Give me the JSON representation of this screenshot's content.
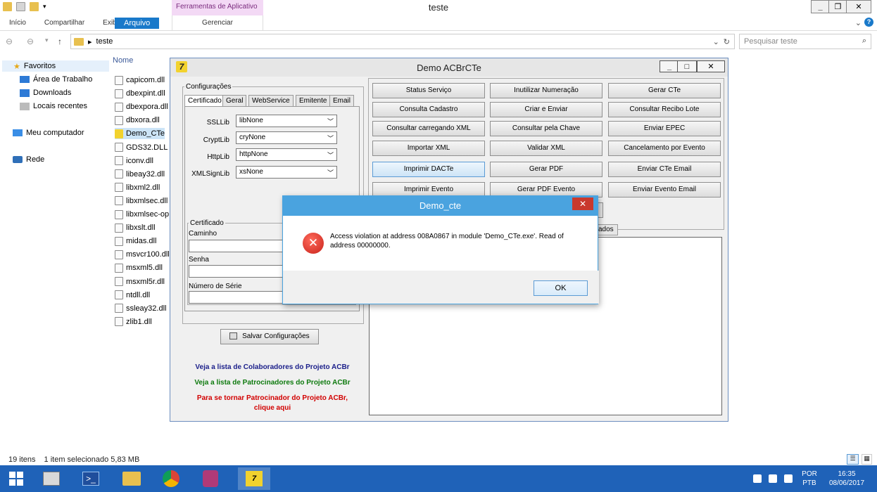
{
  "explorer": {
    "window_title": "teste",
    "context_tab": "Ferramentas de Aplicativo",
    "context_subtab": "Gerenciar",
    "ribbon_tabs": [
      "Arquivo",
      "Início",
      "Compartilhar",
      "Exibir"
    ],
    "breadcrumb": "teste",
    "search_placeholder": "Pesquisar teste",
    "nav": {
      "favorites": "Favoritos",
      "desktop": "Área de Trabalho",
      "downloads": "Downloads",
      "recent": "Locais recentes",
      "computer": "Meu computador",
      "network": "Rede"
    },
    "column_name": "Nome",
    "files": [
      "capicom.dll",
      "dbexpint.dll",
      "dbexpora.dll",
      "dbxora.dll",
      "Demo_CTe",
      "GDS32.DLL",
      "iconv.dll",
      "libeay32.dll",
      "libxml2.dll",
      "libxmlsec.dll",
      "libxmlsec-op",
      "libxslt.dll",
      "midas.dll",
      "msvcr100.dll",
      "msxml5.dll",
      "msxml5r.dll",
      "ntdll.dll",
      "ssleay32.dll",
      "zlib1.dll"
    ],
    "status_count": "19 itens",
    "status_selected": "1 item selecionado  5,83 MB"
  },
  "acbr": {
    "title": "Demo ACBrCTe",
    "config_group": "Configurações",
    "tabs": [
      "Certificado",
      "Geral",
      "WebService",
      "Emitente",
      "Email"
    ],
    "fields": {
      "ssl_label": "SSLLib",
      "ssl_value": "libNone",
      "crypt_label": "CryptLib",
      "crypt_value": "cryNone",
      "http_label": "HttpLib",
      "http_value": "httpNone",
      "xml_label": "XMLSignLib",
      "xml_value": "xsNone"
    },
    "cert_group": "Certificado",
    "cert_path": "Caminho",
    "cert_password": "Senha",
    "cert_serial": "Número de Série",
    "save_button": "Salvar Configurações",
    "links": {
      "collaborators": "Veja a lista de Colaboradores do Projeto ACBr",
      "sponsors": "Veja a lista de Patrocinadores do Projeto ACBr",
      "become_line1": "Para se tornar Patrocinador do Projeto ACBr,",
      "become_line2": "clique aqui"
    },
    "buttons": [
      [
        "Status Serviço",
        "Inutilizar Numeração",
        "Gerar CTe"
      ],
      [
        "Consulta Cadastro",
        "Criar e Enviar",
        "Consultar Recibo Lote"
      ],
      [
        "Consultar carregando XML",
        "Consultar pela Chave",
        "Enviar EPEC"
      ],
      [
        "Importar XML",
        "Validar XML",
        "Cancelamento por Evento"
      ],
      [
        "Imprimir DACTe",
        "Gerar PDF",
        "Enviar CTe Email"
      ],
      [
        "Imprimir Evento",
        "Gerar PDF Evento",
        "Enviar Evento Email"
      ]
    ],
    "partial_tab": "ados"
  },
  "dialog": {
    "title": "Demo_cte",
    "message": "Access violation at address 008A0867 in module 'Demo_CTe.exe'. Read of address 00000000.",
    "ok_label": "OK"
  },
  "taskbar": {
    "lang": "POR",
    "layout": "PTB",
    "time": "16:35",
    "date": "08/06/2017"
  }
}
